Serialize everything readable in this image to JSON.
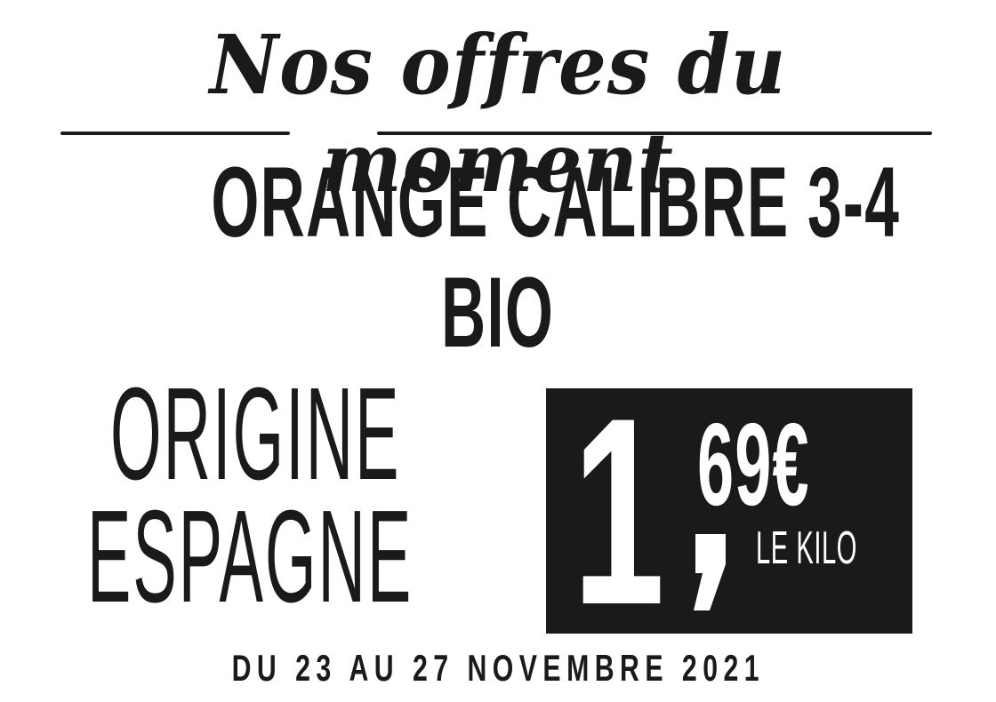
{
  "header": {
    "title": "Nos offres du moment"
  },
  "product": {
    "line1": "ORANGE CALIBRE 3-4",
    "line2": "BIO"
  },
  "origin": {
    "line1": "ORIGINE",
    "line2": "ESPAGNE"
  },
  "price": {
    "integer": "1",
    "separator": ",",
    "decimals": "69€",
    "unit": "LE KILO"
  },
  "validity": {
    "text": "DU 23 AU 27 NOVEMBRE 2021"
  },
  "colors": {
    "ink": "#1a1a1a",
    "background": "#ffffff",
    "price_box": "#1a1a1a",
    "price_text": "#ffffff"
  }
}
